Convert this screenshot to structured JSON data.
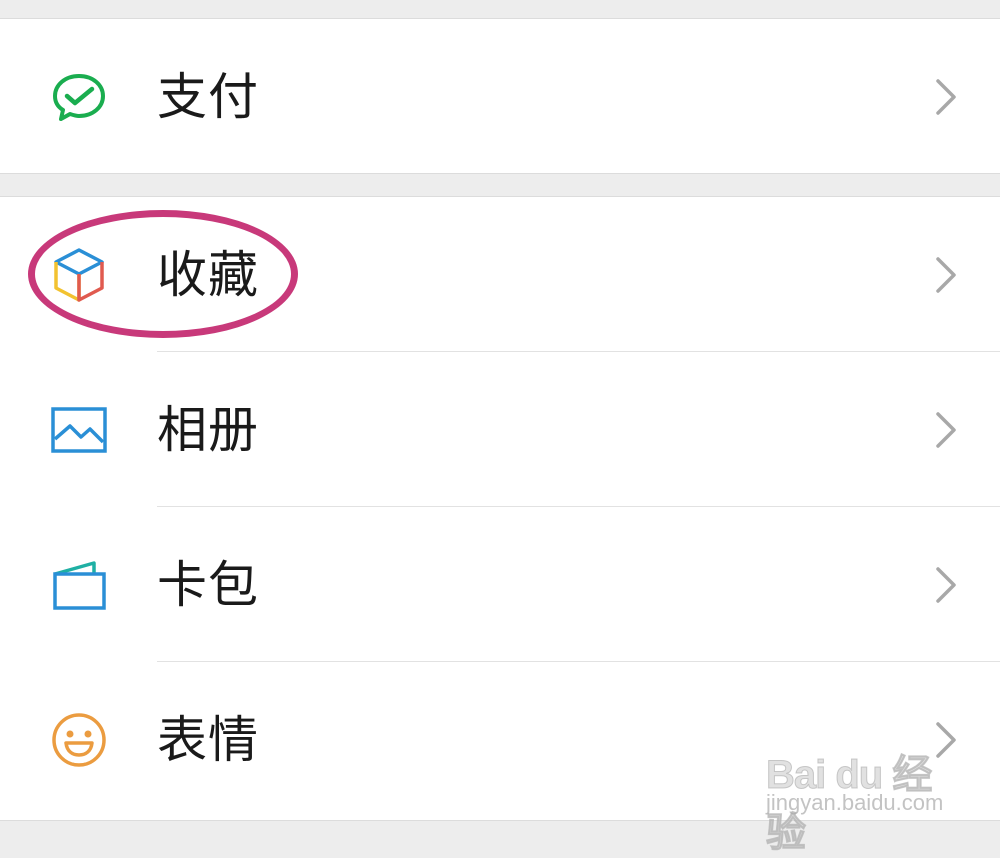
{
  "menu_groups": [
    {
      "items": [
        {
          "label": "支付",
          "icon": "wechat-pay-icon"
        }
      ]
    },
    {
      "items": [
        {
          "label": "收藏",
          "icon": "favorites-cube-icon"
        },
        {
          "label": "相册",
          "icon": "album-picture-icon"
        },
        {
          "label": "卡包",
          "icon": "card-wallet-icon"
        },
        {
          "label": "表情",
          "icon": "smiley-face-icon"
        }
      ]
    }
  ],
  "watermark": {
    "logo_text": "Bai du 经验",
    "url_text": "jingyan.baidu.com"
  },
  "colors": {
    "background": "#ededed",
    "row_background": "#ffffff",
    "highlight": "#c8397a",
    "pay_green": "#1aad4f",
    "blue": "#2a8fd6",
    "orange": "#eb9c40",
    "chevron": "#a8a8a8"
  }
}
